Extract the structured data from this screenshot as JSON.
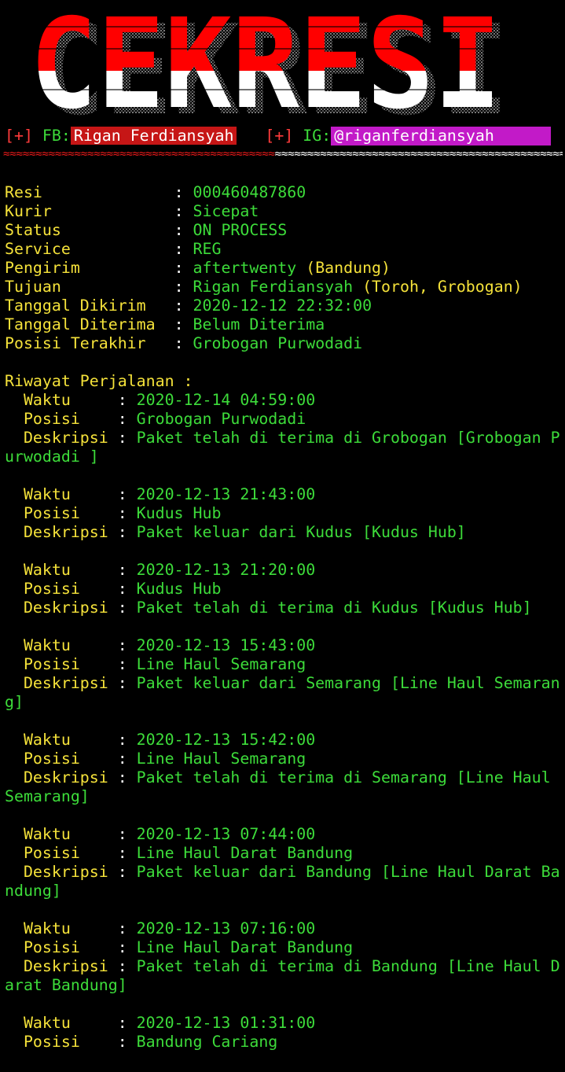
{
  "banner": {
    "text": "CEKRESI"
  },
  "credits": {
    "fb_prefix": "[+]",
    "fb_label": "FB:",
    "fb_name": "Rigan Ferdiansyah",
    "ig_prefix": "[+]",
    "ig_label": "IG:",
    "ig_handle": "@riganferdiansyah",
    "sep_red": "≈≈≈≈≈≈≈≈≈≈≈≈≈≈≈≈≈≈≈≈≈≈≈≈≈≈≈≈≈≈≈≈≈≈≈≈≈≈≈≈≈≈",
    "sep_white": "≈≈≈≈≈≈≈≈≈≈≈≈≈≈≈≈≈≈≈≈≈≈≈≈≈≈≈≈≈≈≈≈≈≈≈≈≈≈≈≈≈≈≈≈≈≈≈"
  },
  "summary": {
    "resi_label": "Resi              ",
    "resi": "000460487860",
    "kurir_label": "Kurir             ",
    "kurir": "Sicepat",
    "status_label": "Status            ",
    "status": "ON PROCESS",
    "service_label": "Service           ",
    "service": "REG",
    "pengirim_label": "Pengirim          ",
    "pengirim_name": "aftertwenty",
    "pengirim_city": "(Bandung)",
    "tujuan_label": "Tujuan            ",
    "tujuan_name": "Rigan Ferdiansyah",
    "tujuan_city": "(Toroh, Grobogan)",
    "dikirim_label": "Tanggal Dikirim   ",
    "dikirim": "2020-12-12 22:32:00",
    "diterima_label": "Tanggal Diterima  ",
    "diterima": "Belum Diterima",
    "posisi_label": "Posisi Terakhir   ",
    "posisi": "Grobogan Purwodadi"
  },
  "history": {
    "title": "Riwayat Perjalanan :",
    "waktu_label": "  Waktu     ",
    "posisi_label": "  Posisi    ",
    "deskripsi_label": "  Deskripsi ",
    "colon": ": ",
    "e1": {
      "waktu": "2020-12-14 04:59:00",
      "posisi": "Grobogan Purwodadi",
      "desc1": "Paket telah di terima di Grobogan [Grobogan P",
      "desc2": "urwodadi ]"
    },
    "e2": {
      "waktu": "2020-12-13 21:43:00",
      "posisi": "Kudus Hub",
      "desc1": "Paket keluar dari Kudus [Kudus Hub]"
    },
    "e3": {
      "waktu": "2020-12-13 21:20:00",
      "posisi": "Kudus Hub",
      "desc1": "Paket telah di terima di Kudus [Kudus Hub]"
    },
    "e4": {
      "waktu": "2020-12-13 15:43:00",
      "posisi": "Line Haul Semarang",
      "desc1": "Paket keluar dari Semarang [Line Haul Semaran",
      "desc2": "g]"
    },
    "e5": {
      "waktu": "2020-12-13 15:42:00",
      "posisi": "Line Haul Semarang",
      "desc1": "Paket telah di terima di Semarang [Line Haul ",
      "desc2": "Semarang]"
    },
    "e6": {
      "waktu": "2020-12-13 07:44:00",
      "posisi": "Line Haul Darat Bandung",
      "desc1": "Paket keluar dari Bandung [Line Haul Darat Ba",
      "desc2": "ndung]"
    },
    "e7": {
      "waktu": "2020-12-13 07:16:00",
      "posisi": "Line Haul Darat Bandung",
      "desc1": "Paket telah di terima di Bandung [Line Haul D",
      "desc2": "arat Bandung]"
    },
    "e8": {
      "waktu": "2020-12-13 01:31:00",
      "posisi": "Bandung Cariang"
    }
  },
  "colors": {
    "label": "#f5e23a",
    "value": "#3ddc3a",
    "fb_bg": "#c61616",
    "ig_bg": "#c21ac8",
    "banner_red": "#ff0000",
    "banner_white": "#ffffff"
  }
}
